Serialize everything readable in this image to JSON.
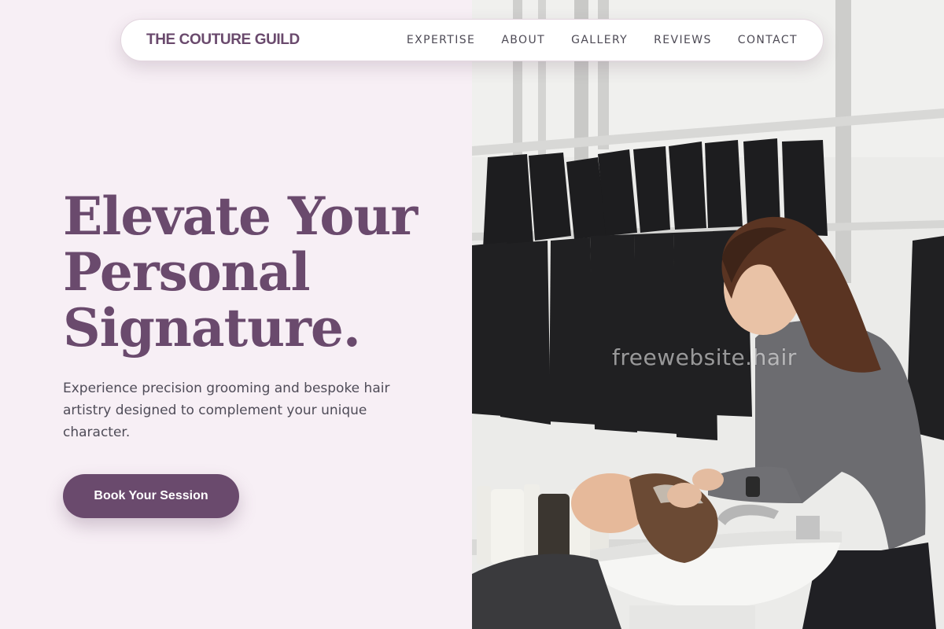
{
  "brand": {
    "name": "THE COUTURE GUILD"
  },
  "nav": {
    "items": [
      {
        "label": "EXPERTISE"
      },
      {
        "label": "ABOUT"
      },
      {
        "label": "GALLERY"
      },
      {
        "label": "REVIEWS"
      },
      {
        "label": "CONTACT"
      }
    ]
  },
  "hero": {
    "headline_lines": [
      "Elevate Your",
      "Personal",
      "Signature."
    ],
    "subtext": "Experience precision grooming and bespoke hair artistry designed to complement your unique character.",
    "cta_label": "Book Your Session"
  },
  "photo": {
    "watermark": "freewebsite.hair",
    "subject": "stylist-washing-client-hair"
  },
  "colors": {
    "accent": "#6a4a6d",
    "background": "#f7eff5",
    "text": "#4f4c58"
  }
}
